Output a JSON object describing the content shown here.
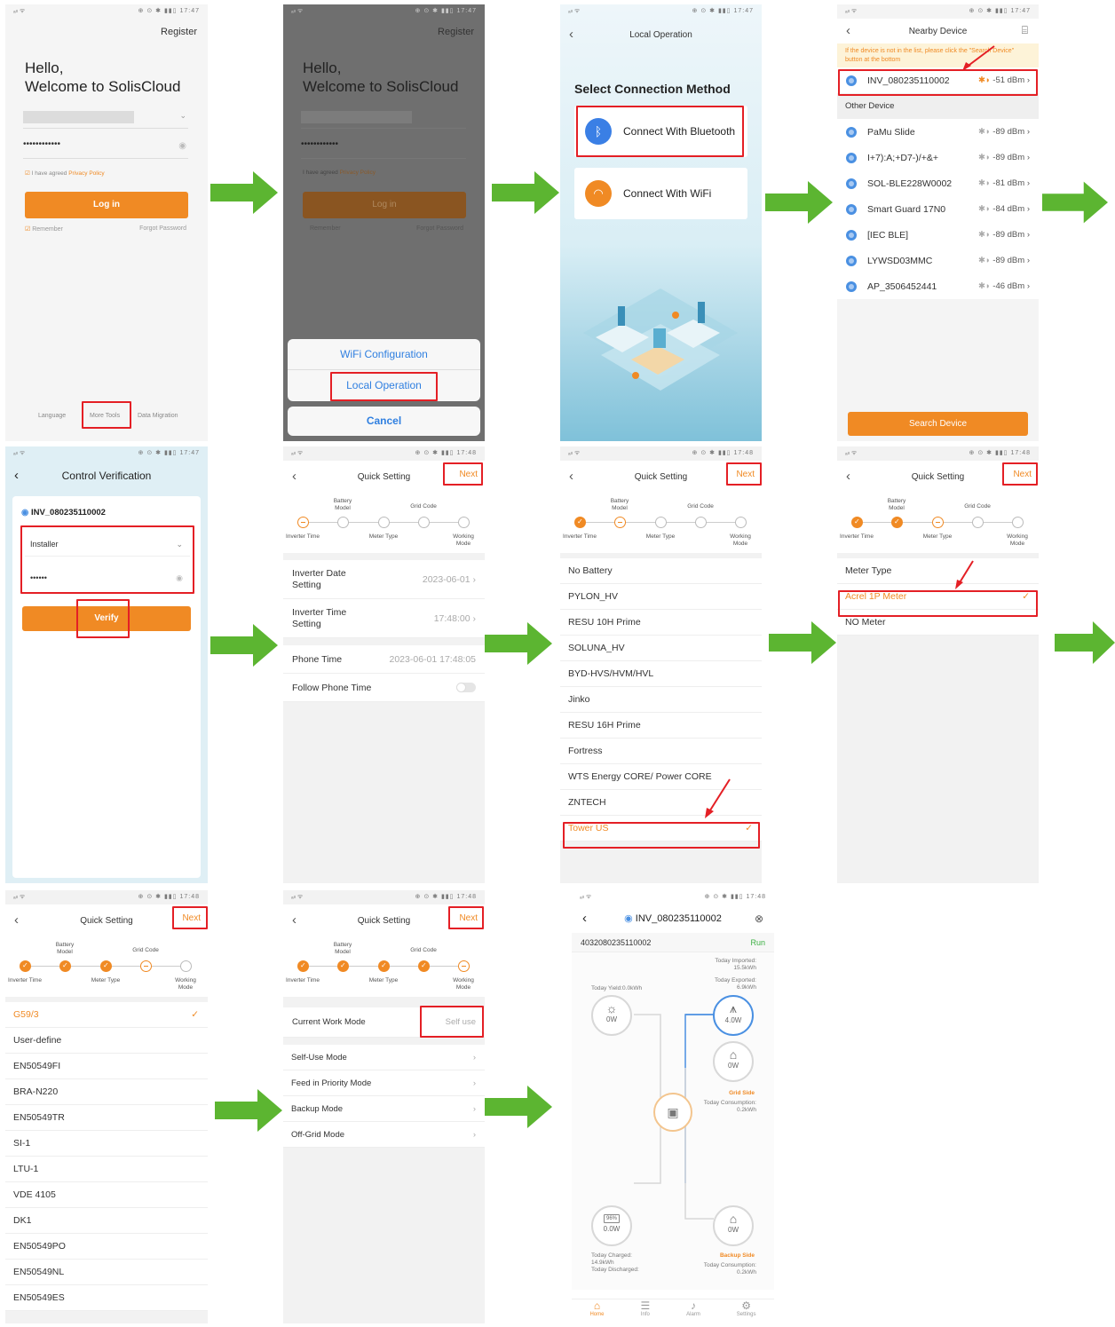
{
  "status": {
    "time1": "17:47",
    "time2": "17:48",
    "icons": "⊕ ⊙ ✱ ▮▮▯"
  },
  "login": {
    "register": "Register",
    "hello": "Hello,",
    "welcome": "Welcome to SolisCloud",
    "password": "••••••••••••",
    "agree_prefix": "I have agreed ",
    "agree_link": "Privacy Policy",
    "login_button": "Log in",
    "remember": "Remember",
    "forgot": "Forgot Password",
    "footer": [
      "Language",
      "More Tools",
      "Data Migration"
    ]
  },
  "sheet": {
    "wifi_config": "WiFi Configuration",
    "local_operation": "Local Operation",
    "cancel": "Cancel"
  },
  "connection": {
    "title": "Local Operation",
    "heading": "Select Connection Method",
    "bluetooth": "Connect With Bluetooth",
    "wifi": "Connect With WiFi"
  },
  "nearby": {
    "title": "Nearby Device",
    "hint": "If the device is not in the list, please click the \"Search Device\" button at the bottom",
    "primary": {
      "name": "INV_080235110002",
      "rssi": "-51 dBm"
    },
    "other_header": "Other Device",
    "devices": [
      {
        "name": "PaMu Slide",
        "rssi": "-89 dBm"
      },
      {
        "name": "I+7):A;+D7-)/+&+",
        "rssi": "-89 dBm"
      },
      {
        "name": "SOL-BLE228W0002",
        "rssi": "-81 dBm"
      },
      {
        "name": "Smart Guard 17N0",
        "rssi": "-84 dBm"
      },
      {
        "name": "[IEC BLE]",
        "rssi": "-89 dBm"
      },
      {
        "name": "LYWSD03MMC",
        "rssi": "-89 dBm"
      },
      {
        "name": "AP_3506452441",
        "rssi": "-46 dBm"
      }
    ],
    "search_button": "Search Device"
  },
  "verify": {
    "title": "Control Verification",
    "device": "INV_080235110002",
    "role": "Installer",
    "password": "••••••",
    "button": "Verify"
  },
  "quick": {
    "title": "Quick Setting",
    "next": "Next",
    "steps_top": [
      "Battery Model",
      "Grid Code"
    ],
    "steps_bottom": [
      "Inverter Time",
      "Meter Type",
      "Working Mode"
    ]
  },
  "time_setting": {
    "date_label": "Inverter Date Setting",
    "date_value": "2023-06-01",
    "time_label": "Inverter Time Setting",
    "time_value": "17:48:00",
    "phone_label": "Phone Time",
    "phone_value": "2023-06-01 17:48:05",
    "follow_label": "Follow Phone Time"
  },
  "battery_models": [
    "No Battery",
    "PYLON_HV",
    "RESU 10H Prime",
    "SOLUNA_HV",
    "BYD-HVS/HVM/HVL",
    "Jinko",
    "RESU 16H Prime",
    "Fortress",
    "WTS Energy CORE/ Power CORE",
    "ZNTECH",
    "Tower US"
  ],
  "meter": {
    "header": "Meter Type",
    "selected": "Acrel 1P Meter",
    "other": "NO Meter"
  },
  "grid_codes": [
    "G59/3",
    "User-define",
    "EN50549FI",
    "BRA-N220",
    "EN50549TR",
    "SI-1",
    "LTU-1",
    "VDE 4105",
    "DK1",
    "EN50549PO",
    "EN50549NL",
    "EN50549ES"
  ],
  "work_mode": {
    "current_label": "Current Work Mode",
    "current_value": "Self use",
    "modes": [
      "Self-Use Mode",
      "Feed in Priority Mode",
      "Backup Mode",
      "Off-Grid Mode"
    ]
  },
  "dashboard": {
    "device": "INV_080235110002",
    "serial": "4032080235110002",
    "status": "Run",
    "imported_label": "Today Imported:",
    "imported": "15.5kWh",
    "exported_label": "Today Exported:",
    "exported": "6.9kWh",
    "yield": "Today Yield:0.0kWh",
    "pv_power": "0W",
    "grid_power": "4.0W",
    "load_power": "0W",
    "grid_side": "Grid Side",
    "today_consumption_label": "Today Consumption:",
    "grid_consumption": "0.2kWh",
    "battery_soc": "96%",
    "battery_power": "0.0W",
    "charged_label": "Today Charged:",
    "charged": "14.9kWh",
    "discharged_label": "Today Discharged:",
    "backup_power": "0W",
    "backup_side": "Backup Side",
    "backup_consumption": "0.2kWh",
    "tabs": [
      "Home",
      "Info",
      "Alarm",
      "Settings"
    ]
  },
  "colors": {
    "accent": "#f08a24",
    "arrow": "#5cb531",
    "highlight": "#e41f25",
    "blue": "#4a90e2"
  }
}
